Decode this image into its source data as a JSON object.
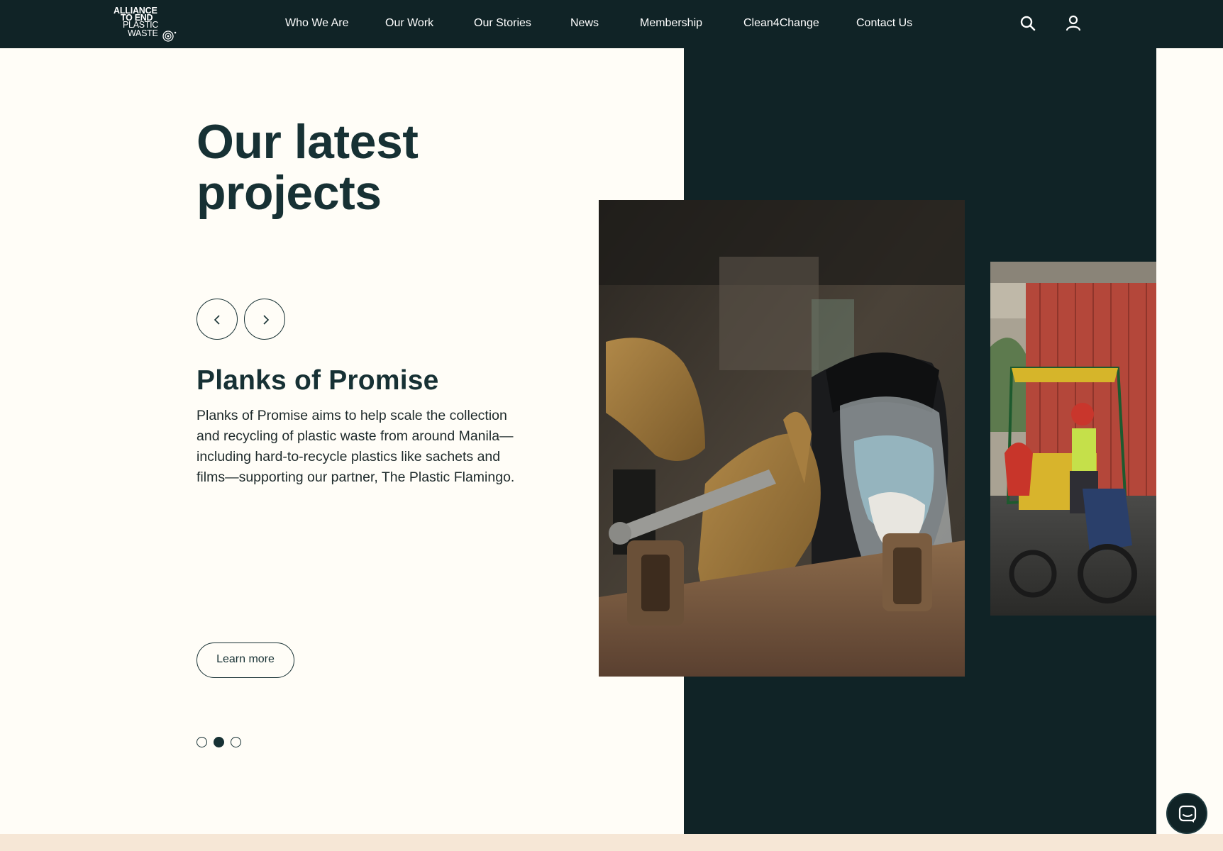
{
  "header": {
    "logo": {
      "line1": "ALLIANCE",
      "line2": "TO END",
      "line3": "PLASTIC",
      "line4": "WASTE"
    },
    "nav": [
      {
        "label": "Who We Are"
      },
      {
        "label": "Our Work"
      },
      {
        "label": "Our Stories"
      },
      {
        "label": "News"
      },
      {
        "label": "Membership"
      },
      {
        "label": "Clean4Change"
      },
      {
        "label": "Contact Us"
      }
    ],
    "icons": [
      "search-icon",
      "user-icon"
    ]
  },
  "section": {
    "heading_line1": "Our latest",
    "heading_line2": "projects",
    "carousel": {
      "prev_icon": "chevron-left-icon",
      "next_icon": "chevron-right-icon",
      "slide_count": 3,
      "active_slide": 2
    },
    "project": {
      "title": "Planks of Promise",
      "description": "Planks of Promise aims to help scale the collection and recycling of plastic waste from around Manila—including hard-to-recycle plastics like sachets and films—supporting our partner, The Plastic Flamingo.",
      "cta_label": "Learn more"
    }
  },
  "chat": {
    "icon": "chat-icon"
  },
  "colors": {
    "dark": "#102326",
    "text": "#173134",
    "background": "#fffdf7",
    "footer": "#f6e7d6"
  }
}
